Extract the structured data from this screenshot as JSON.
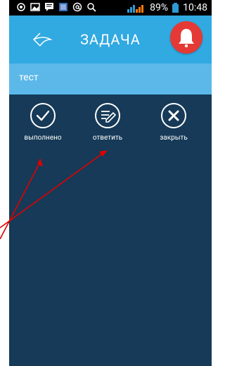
{
  "status_bar": {
    "battery": "89%",
    "time": "10:48",
    "icons": [
      "navigation-icon",
      "image-icon",
      "chat-icon",
      "app-icon",
      "at-icon",
      "search-icon",
      "signal-icon",
      "battery-icon"
    ]
  },
  "app_bar": {
    "title": "ЗАДАЧА",
    "back_icon": "back-icon",
    "bell_icon": "bell-icon"
  },
  "task": {
    "title": "тест"
  },
  "actions": [
    {
      "label": "выполнено",
      "icon": "check-circle-icon"
    },
    {
      "label": "ответить",
      "icon": "edit-circle-icon"
    },
    {
      "label": "закрыть",
      "icon": "close-circle-icon"
    }
  ],
  "colors": {
    "status_bar": "#000000",
    "app_bar": "#31a9e1",
    "task_bar": "#5bb8e8",
    "content_bg": "#163a57",
    "bell_bg": "#e53935",
    "annotation_arrows": "#e00000"
  }
}
